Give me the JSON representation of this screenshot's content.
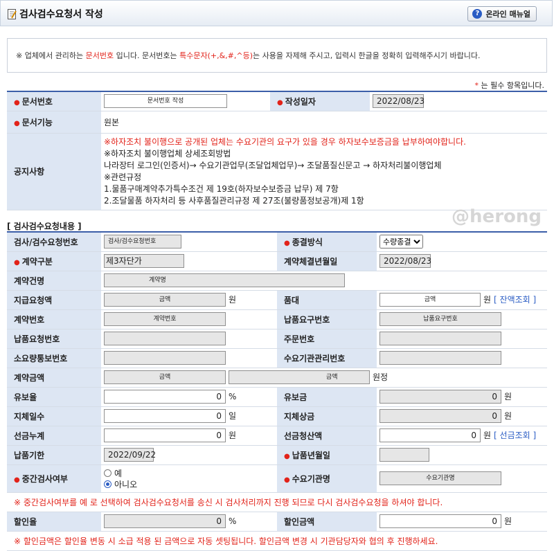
{
  "header": {
    "title": "검사검수요청서 작성",
    "manual_label": "온라인 매뉴얼"
  },
  "notice": {
    "prefix": "※ 업체에서 관리하는 ",
    "hl1": "문서번호",
    "mid1": " 입니다. 문서번호는 ",
    "hl2": "특수문자(+,&,#,^등)",
    "suffix": "는 사용을 자제해 주시고, 입력시 한글을 정확히 입력해주시기 바랍니다."
  },
  "required_note": {
    "star": "*",
    "text": " 는 필수 항목입니다."
  },
  "top": {
    "doc_no_label": "문서번호",
    "doc_no_value": "문서번호 작성",
    "date_label": "작성일자",
    "date_value": "2022/08/23",
    "func_label": "문서기능",
    "func_value": "원본",
    "notice_label": "공지사항",
    "notice_lines": [
      "※하자조치 불이행으로 공개된 업체는 수요기관의 요구가 있을 경우 하자보수보증금을 납부하여야합니다.",
      "※하자조치 불이행업체 상세조회방법",
      "나라장터 로그인(인증서)→ 수요기관업무(조달업체업무)→ 조달품질신문고 → 하자처리불이행업체",
      "※관련규정",
      "1.물품구매계약추가특수조건 제 19호(하자보수보증금 납무) 제 7항",
      "2.조달물품 하자처리 등 사후품질관리규정 제 27조(불량품정보공개)제 1항"
    ]
  },
  "section_title": "[ 검사검수요청내용 ]",
  "watermark": "@herong",
  "form": {
    "req_no_label": "검사/검수요청번호",
    "req_no_value": "검사/검수요청번호",
    "end_method_label": "종결방식",
    "end_method_value": "수량종결",
    "contract_type_label": "계약구분",
    "contract_type_value": "제3자단가",
    "contract_date_label": "계약체결년월일",
    "contract_date_value": "2022/08/23",
    "contract_name_label": "계약건명",
    "contract_name_value": "계약명",
    "pay_req_label": "지급요청액",
    "pay_req_value": "금액",
    "won": "원",
    "price_label": "품대",
    "price_value": "금액",
    "balance_link": "[ 잔액조회 ]",
    "contract_no_label": "계약번호",
    "contract_no_value": "계약번호",
    "delivery_req_no_label": "납품요구번호",
    "delivery_req_no_value": "납품요구번호",
    "delivery_request_no_label": "납품요청번호",
    "order_no_label": "주문번호",
    "notice_no_label": "소요량통보번호",
    "agency_mgmt_no_label": "수요기관관리번호",
    "contract_amount_label": "계약금액",
    "contract_amount_value1": "금액",
    "contract_amount_value2": "금액",
    "won_fixed": "원정",
    "retention_rate_label": "유보율",
    "retention_rate_value": "0",
    "percent": "%",
    "retention_amount_label": "유보금",
    "retention_amount_value": "0",
    "delay_days_label": "지체일수",
    "delay_days_value": "0",
    "day_unit": "일",
    "delay_penalty_label": "지체상금",
    "delay_penalty_value": "0",
    "advance_total_label": "선금누계",
    "advance_total_value": "0",
    "advance_settle_label": "선금청산액",
    "advance_settle_value": "0",
    "advance_link": "[ 선금조회 ]",
    "deadline_label": "납품기한",
    "deadline_value": "2022/09/22",
    "delivery_month_label": "납품년월일",
    "mid_inspect_label": "중간검사여부",
    "mid_yes": "예",
    "mid_no": "아니오",
    "agency_name_label": "수요기관명",
    "agency_name_value": "수요기관명",
    "mid_warning": "※ 중간검사여부를 예 로 선택하여 검사검수요청서를 송신 시 검사처리까지 진행 되므로 다시 검사검수요청을 하셔야 합니다.",
    "discount_rate_label": "할인율",
    "discount_rate_value": "0",
    "discount_amount_label": "할인금액",
    "discount_amount_value": "0",
    "discount_warning": "※ 할인금액은 할인율 변동 시 소급 적용 된 금액으로 자동 셋팅됩니다. 할인금액 변경 시 기관담당자와 협의 후 진행하세요."
  },
  "colors": {
    "label_bg": "#dde6f3",
    "required": "#e2231a",
    "link": "#2a5cc4"
  }
}
